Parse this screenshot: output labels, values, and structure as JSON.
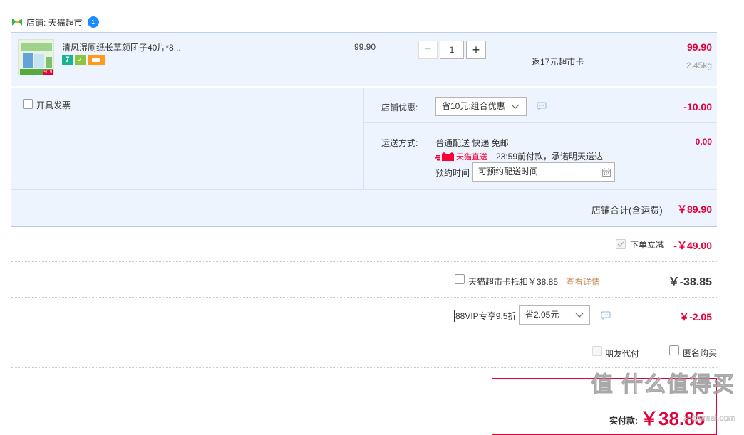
{
  "shop": {
    "label": "店铺: 天猫超市"
  },
  "item": {
    "title": "清风湿厕纸长草颜团子40片*8...",
    "thumb_badge_price": "50.9",
    "unit_price": "99.90",
    "quantity": "1",
    "rebate_text": "返17元超市卡",
    "total": "99.90",
    "weight": "2.45kg",
    "badge_seven": "7"
  },
  "invoice": {
    "label": "开具发票"
  },
  "shop_discount": {
    "label": "店铺优惠:",
    "selected": "省10元:组合优惠",
    "amount": "-10.00"
  },
  "shipping": {
    "label": "运送方式:",
    "method": "普通配送 快递 免邮",
    "brand": "天猫直送",
    "promise": "23:59前付款，承诺明天送达",
    "reserve_label": "预约时间",
    "reserve_placeholder": "可预约配送时间",
    "fee": "0.00"
  },
  "shop_total": {
    "label": "店铺合计(含运费)",
    "amount": "￥89.90"
  },
  "instant_discount": {
    "label": "下单立减",
    "amount": "-￥49.00"
  },
  "supermarket_card": {
    "label": "天猫超市卡抵扣￥38.85",
    "link": "查看详情",
    "amount": "￥-38.85"
  },
  "vip": {
    "label": "88VIP专享9.5折",
    "selected": "省2.05元",
    "amount": "￥-2.05"
  },
  "options": {
    "friend_pay": "朋友代付",
    "anonymous": "匿名购买"
  },
  "payment": {
    "label": "实付款:",
    "amount": "￥38.85"
  },
  "watermark": {
    "text": "值 什么值得买",
    "domain": "zhidemai.com"
  },
  "colors": {
    "price_red": "#e4003a",
    "panel_blue": "#eef4fd",
    "tmall_red": "#ff0036",
    "link_orange": "#c48f5b"
  }
}
